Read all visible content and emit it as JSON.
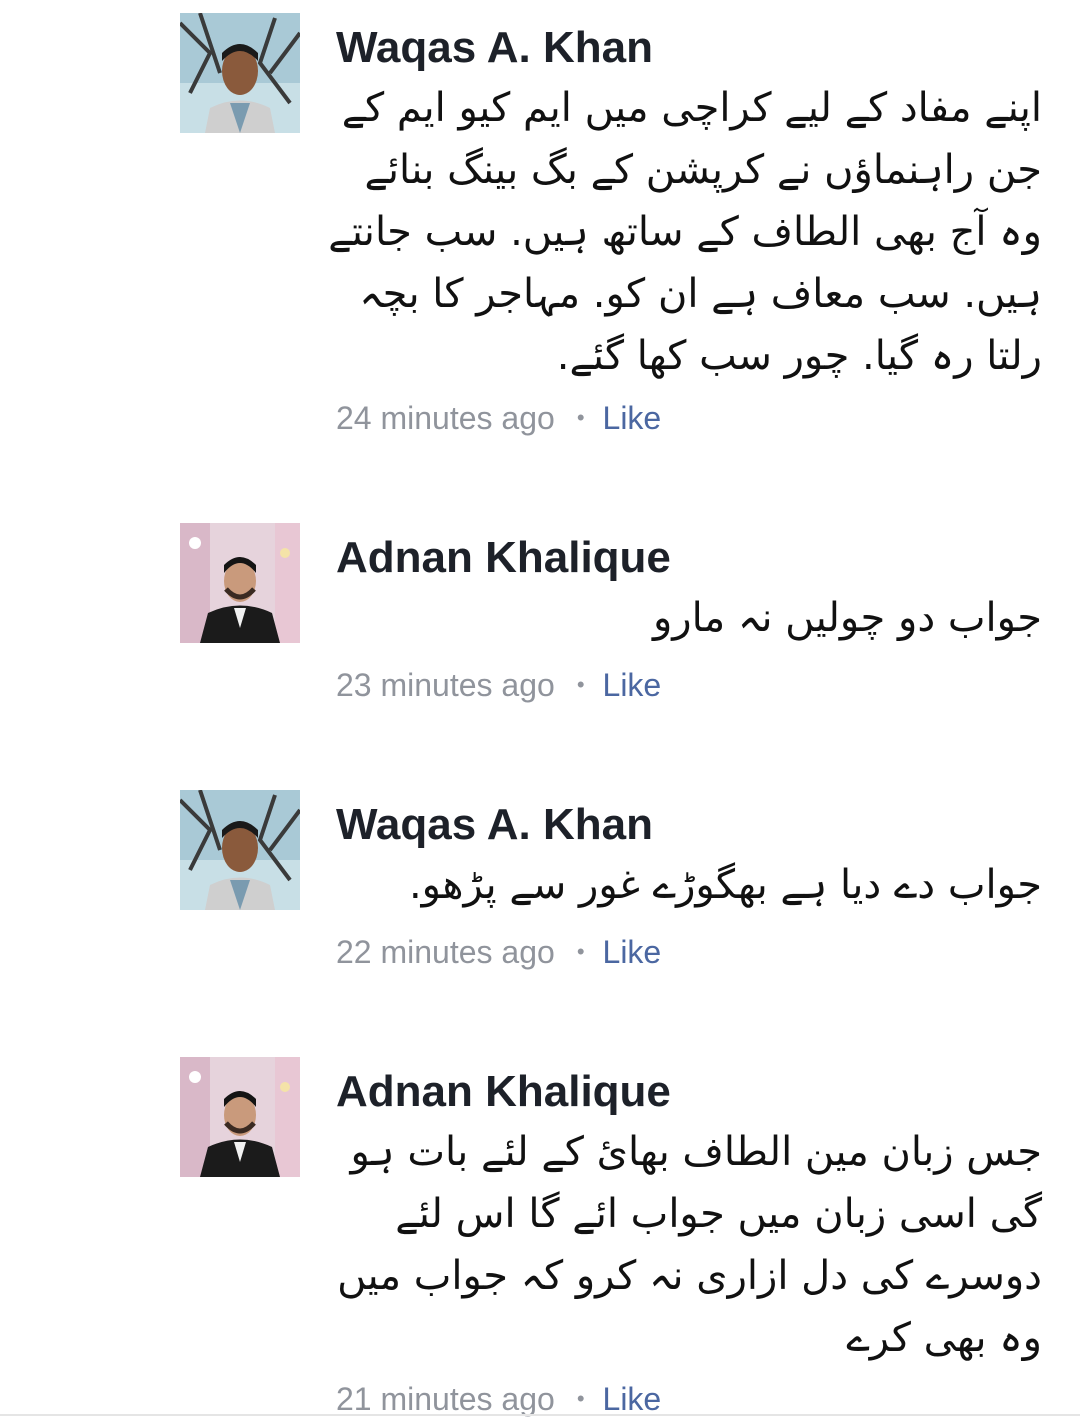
{
  "comments": [
    {
      "author": "Waqas A. Khan",
      "avatar_icon": "profile-photo-man-outdoors",
      "text": "اپنے مفاد کے لیے کراچی میں ایم کیو ایم کے جن راہنماؤں نے کرپشن کے بگ بینگ بنائے وہ آج بھی الطاف کے ساتھ ہیں. سب جانتے ہیں. سب معاف ہے ان کو. مہاجر کا بچہ رلتا رہ گیا. چور سب کھا گئے.",
      "time": "24 minutes ago",
      "separator": "•",
      "like": "Like"
    },
    {
      "author": "Adnan Khalique",
      "avatar_icon": "profile-photo-man-in-suit",
      "text": "جواب دو چولیں نہ مارو",
      "time": "23 minutes ago",
      "separator": "•",
      "like": "Like"
    },
    {
      "author": "Waqas A. Khan",
      "avatar_icon": "profile-photo-man-outdoors",
      "text": "جواب دے دیا ہے بھگوڑے غور سے پڑھو.",
      "time": "22 minutes ago",
      "separator": "•",
      "like": "Like"
    },
    {
      "author": "Adnan Khalique",
      "avatar_icon": "profile-photo-man-in-suit",
      "text": "جس زبان مین الطاف بھائ کے لئے بات ہو گی اسی زبان میں جواب ائے گا اس لئے دوسرے کی دل ازاری نہ کرو کہ جواب میں وہ بھی کرے",
      "time": "21 minutes ago",
      "separator": "•",
      "like": "Like"
    }
  ],
  "colors": {
    "author": "#1d2129",
    "meta": "#90949c",
    "link": "#4b67a1"
  }
}
